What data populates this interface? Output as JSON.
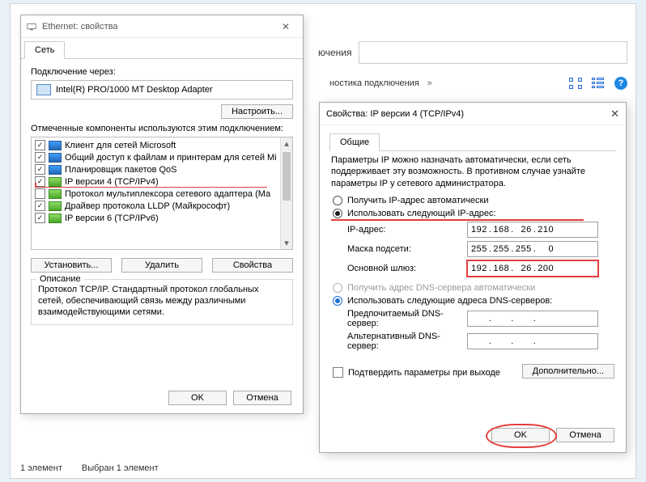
{
  "bg": {
    "toolbar_label": "ючения",
    "row2_label": "ностика подключения",
    "chev": "»",
    "status_left": "1 элемент",
    "status_right": "Выбран 1 элемент"
  },
  "eth": {
    "title": "Ethernet: свойства",
    "tab": "Сеть",
    "connect_via": "Подключение через:",
    "adapter": "Intel(R) PRO/1000 MT Desktop Adapter",
    "configure": "Настроить...",
    "components_label": "Отмеченные компоненты используются этим подключением:",
    "items": [
      {
        "checked": true,
        "ico": "net",
        "label": "Клиент для сетей Microsoft"
      },
      {
        "checked": true,
        "ico": "net",
        "label": "Общий доступ к файлам и принтерам для сетей Mi"
      },
      {
        "checked": true,
        "ico": "net",
        "label": "Планировщик пакетов QoS"
      },
      {
        "checked": true,
        "ico": "green",
        "label": "IP версии 4 (TCP/IPv4)"
      },
      {
        "checked": false,
        "ico": "green",
        "label": "Протокол мультиплексора сетевого адаптера (Ма"
      },
      {
        "checked": true,
        "ico": "green",
        "label": "Драйвер протокола LLDP (Майкрософт)"
      },
      {
        "checked": true,
        "ico": "green",
        "label": "IP версии 6 (TCP/IPv6)"
      }
    ],
    "install": "Установить...",
    "uninstall": "Удалить",
    "properties": "Свойства",
    "desc_legend": "Описание",
    "desc_text": "Протокол TCP/IP. Стандартный протокол глобальных сетей, обеспечивающий связь между различными взаимодействующими сетями.",
    "ok": "OK",
    "cancel": "Отмена"
  },
  "ip": {
    "title": "Свойства: IP версии 4 (TCP/IPv4)",
    "tab": "Общие",
    "intro": "Параметры IP можно назначать автоматически, если сеть поддерживает эту возможность. В противном случае узнайте параметры IP у сетевого администратора.",
    "radio_auto": "Получить IP-адрес автоматически",
    "radio_static": "Использовать следующий IP-адрес:",
    "lbl_ip": "IP-адрес:",
    "lbl_mask": "Маска подсети:",
    "lbl_gw": "Основной шлюз:",
    "val_ip": [
      "192",
      "168",
      "26",
      "210"
    ],
    "val_mask": [
      "255",
      "255",
      "255",
      "0"
    ],
    "val_gw": [
      "192",
      "168",
      "26",
      "200"
    ],
    "radio_dns_auto": "Получить адрес DNS-сервера автоматически",
    "radio_dns_static": "Использовать следующие адреса DNS-серверов:",
    "lbl_dns1": "Предпочитаемый DNS-сервер:",
    "lbl_dns2": "Альтернативный DNS-сервер:",
    "val_dns1": [
      "",
      "",
      "",
      ""
    ],
    "val_dns2": [
      "",
      "",
      "",
      ""
    ],
    "validate": "Подтвердить параметры при выходе",
    "advanced": "Дополнительно...",
    "ok": "OK",
    "cancel": "Отмена"
  }
}
